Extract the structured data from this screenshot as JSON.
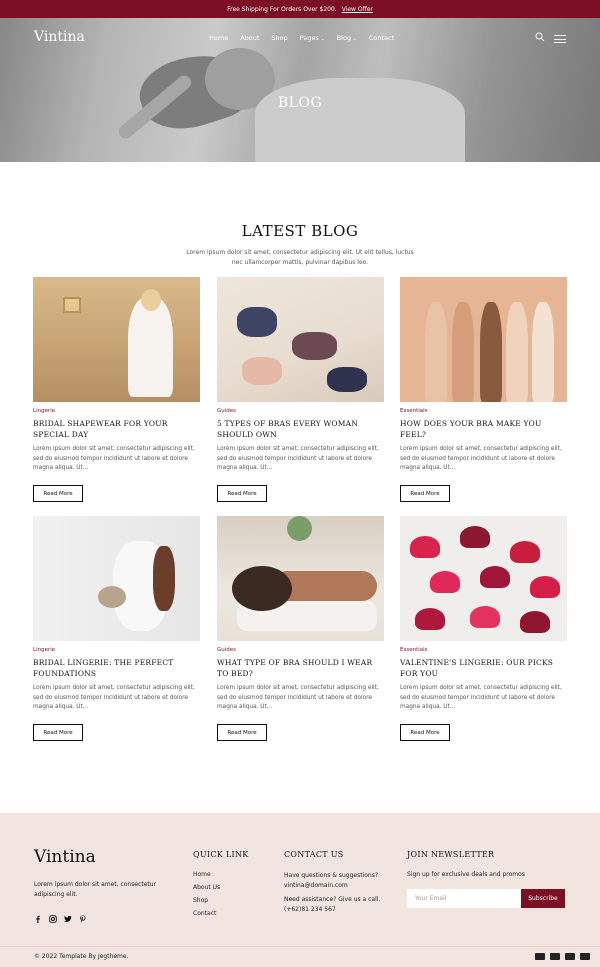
{
  "colors": {
    "brand": "#7a0f26",
    "footer_bg": "#f2e5df"
  },
  "topbar": {
    "text": "Free Shipping For Orders Over $200.",
    "offer_link": "View Offer"
  },
  "header": {
    "logo": "Vintina",
    "nav": [
      {
        "label": "Home"
      },
      {
        "label": "About"
      },
      {
        "label": "Shop"
      },
      {
        "label": "Pages"
      },
      {
        "label": "Blog"
      },
      {
        "label": "Contact"
      }
    ],
    "icons": [
      "search-icon",
      "menu-icon"
    ]
  },
  "hero": {
    "title": "BLOG"
  },
  "latest": {
    "title": "LATEST BLOG",
    "description": "Lorem ipsum dolor sit amet, consectetur adipiscing elit. Ut elit tellus, luctus nec ullamcorper mattis, pulvinar dapibus leo."
  },
  "posts": [
    {
      "category": "Lingerie",
      "title": "BRIDAL SHAPEWEAR FOR YOUR SPECIAL DAY",
      "excerpt": "Lorem ipsum dolor sit amet, consectetur adipiscing elit, sed do eiusmod tempor incididunt ut labore et dolore magna aliqua. Ut...",
      "button": "Read More"
    },
    {
      "category": "Guides",
      "title": "5 TYPES OF BRAS EVERY WOMAN SHOULD OWN",
      "excerpt": "Lorem ipsum dolor sit amet, consectetur adipiscing elit, sed do eiusmod tempor incididunt ut labore et dolore magna aliqua. Ut...",
      "button": "Read More"
    },
    {
      "category": "Essentials",
      "title": "HOW DOES YOUR BRA MAKE YOU FEEL?",
      "excerpt": "Lorem ipsum dolor sit amet, consectetur adipiscing elit, sed do eiusmod tempor incididunt ut labore et dolore magna aliqua. Ut...",
      "button": "Read More"
    },
    {
      "category": "Lingerie",
      "title": "BRIDAL LINGERIE: THE PERFECT FOUNDATIONS",
      "excerpt": "Lorem ipsum dolor sit amet, consectetur adipiscing elit, sed do eiusmod tempor incididunt ut labore et dolore magna aliqua. Ut...",
      "button": "Read More"
    },
    {
      "category": "Guides",
      "title": "WHAT TYPE OF BRA SHOULD I WEAR TO BED?",
      "excerpt": "Lorem ipsum dolor sit amet, consectetur adipiscing elit, sed do eiusmod tempor incididunt ut labore et dolore magna aliqua. Ut...",
      "button": "Read More"
    },
    {
      "category": "Essentials",
      "title": "VALENTINE'S LINGERIE: OUR PICKS FOR YOU",
      "excerpt": "Lorem ipsum dolor sit amet, consectetur adipiscing elit, sed do eiusmod tempor incididunt ut labore et dolore magna aliqua. Ut...",
      "button": "Read More"
    }
  ],
  "footer": {
    "logo": "Vintina",
    "description": "Lorem ipsum dolor sit amet, consectetur adipiscing elit.",
    "social_icons": [
      "facebook-icon",
      "instagram-icon",
      "twitter-icon",
      "pinterest-icon"
    ],
    "quick_link": {
      "title": "QUICK LINK",
      "links": [
        "Home",
        "About Us",
        "Shop",
        "Contact"
      ]
    },
    "contact": {
      "title": "CONTACT US",
      "q1": "Have questions & suggestions?",
      "email": "vintina@domain.com",
      "q2": "Need assistance? Give us a call.",
      "phone": "(+62)81 234 567"
    },
    "newsletter": {
      "title": "JOIN NEWSLETTER",
      "description": "Sign up for exclusive deals and promos",
      "placeholder": "Your Email",
      "button": "Subscribe"
    },
    "copyright": "© 2022 Template By Jegtheme.",
    "payment_icons": [
      "mastercard-icon",
      "paypal-icon",
      "visa-icon",
      "card-icon"
    ]
  }
}
